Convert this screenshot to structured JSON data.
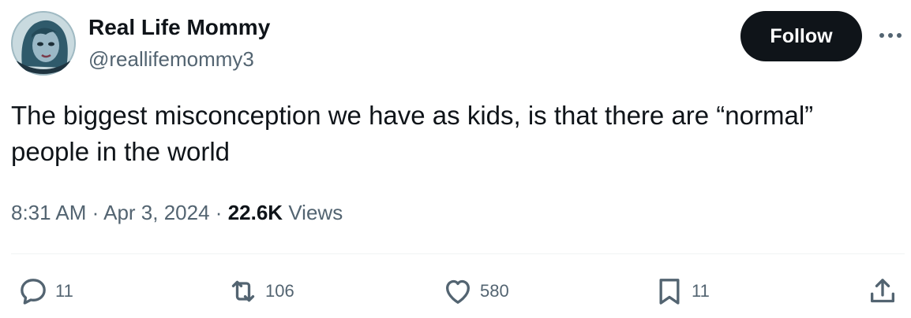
{
  "author": {
    "display_name": "Real Life Mommy",
    "handle": "@reallifemommy3"
  },
  "follow_label": "Follow",
  "tweet": {
    "text": "The biggest misconception we have as kids, is that there are “normal” people in the world"
  },
  "meta": {
    "time": "8:31 AM",
    "separator": "·",
    "date": "Apr 3, 2024",
    "views_count": "22.6K",
    "views_label": "Views"
  },
  "actions": {
    "replies": "11",
    "reposts": "106",
    "likes": "580",
    "bookmarks": "11"
  },
  "icons": {
    "reply": "reply-bubble-icon",
    "repost": "repost-arrows-icon",
    "like": "heart-icon",
    "bookmark": "bookmark-icon",
    "share": "share-upload-icon",
    "more": "more-dots-icon"
  },
  "colors": {
    "text_primary": "#0f1419",
    "text_secondary": "#536471",
    "follow_bg": "#0f1419",
    "divider": "#eff3f4"
  }
}
